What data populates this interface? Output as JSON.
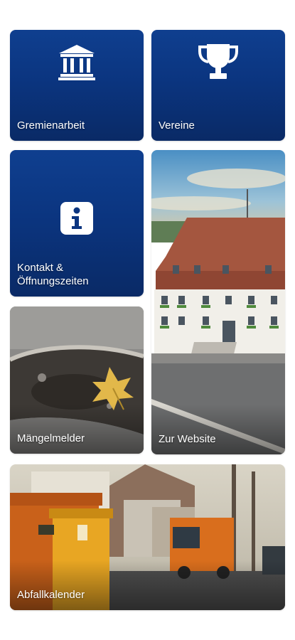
{
  "tiles": {
    "gremienarbeit": {
      "label": "Gremienarbeit",
      "icon": "building-columns-icon"
    },
    "vereine": {
      "label": "Vereine",
      "icon": "trophy-icon"
    },
    "kontakt": {
      "label": "Kontakt &\nÖffnungszeiten",
      "icon": "info-icon"
    },
    "website": {
      "label": "Zur Website",
      "image": "town-hall-photo"
    },
    "maengelmelder": {
      "label": "Mängelmelder",
      "image": "pothole-leaf-photo"
    },
    "abfallkalender": {
      "label": "Abfallkalender",
      "image": "waste-bins-truck-photo"
    }
  },
  "colors": {
    "tile_blue_top": "#0f3f8f",
    "tile_blue_bottom": "#0a2a66",
    "label": "#ffffff"
  }
}
